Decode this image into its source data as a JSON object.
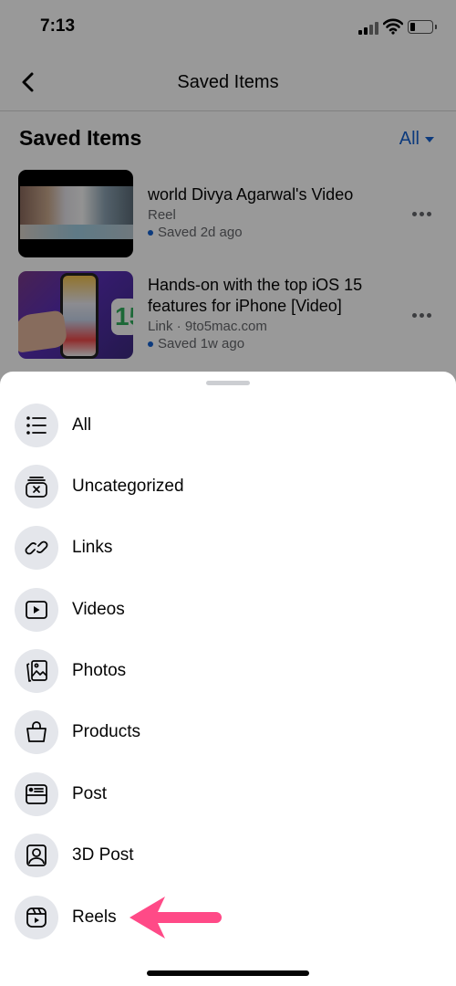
{
  "status_bar": {
    "time": "7:13"
  },
  "nav": {
    "title": "Saved Items"
  },
  "section": {
    "title": "Saved Items",
    "filter_label": "All"
  },
  "saved_items": [
    {
      "title": "world Divya Agarwal's Video",
      "subtitle": "Reel",
      "saved": "Saved 2d ago"
    },
    {
      "title": "Hands-on with the top iOS 15 features for iPhone [Video]",
      "subtitle": "Link · 9to5mac.com",
      "saved": "Saved 1w ago",
      "thumb_badge": "15"
    }
  ],
  "sheet": {
    "items": [
      {
        "label": "All",
        "icon": "list-icon"
      },
      {
        "label": "Uncategorized",
        "icon": "uncategorized-box-icon"
      },
      {
        "label": "Links",
        "icon": "link-icon"
      },
      {
        "label": "Videos",
        "icon": "video-play-icon"
      },
      {
        "label": "Photos",
        "icon": "photos-icon"
      },
      {
        "label": "Products",
        "icon": "shopping-bag-icon"
      },
      {
        "label": "Post",
        "icon": "post-icon"
      },
      {
        "label": "3D Post",
        "icon": "3d-post-icon"
      },
      {
        "label": "Reels",
        "icon": "reels-icon"
      }
    ]
  },
  "colors": {
    "accent": "#1461d1",
    "annotation_arrow": "#ff4a87",
    "icon_bg": "#e4e6eb"
  }
}
